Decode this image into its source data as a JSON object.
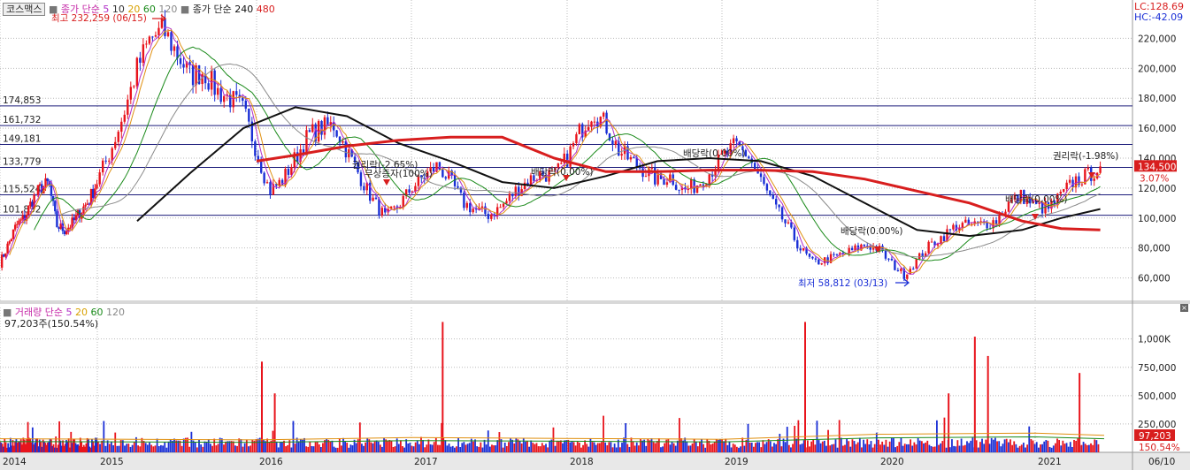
{
  "header": {
    "name": "코스맥스",
    "price_legend": [
      "종가",
      "단순",
      "5",
      "10",
      "20",
      "60",
      "120",
      "종가",
      "단순",
      "240",
      "480"
    ],
    "lc": "LC:128.69",
    "hc": "HC:-42.09"
  },
  "volume_header": {
    "legend": [
      "거래량",
      "단순",
      "5",
      "20",
      "60",
      "120"
    ],
    "last": "97,203주(150.54%)"
  },
  "colors": {
    "up": "#e8141c",
    "down": "#1a2fd6",
    "ma5": "#b02fc8",
    "ma10": "#d8b800",
    "ma20": "#e09010",
    "ma60": "#1a8a1a",
    "ma120": "#8a8a8a",
    "ma240": "#111111",
    "ma480": "#d81e1e",
    "hline": "#1b1b7a"
  },
  "annotations": {
    "high": "최고 232,259 (06/15)",
    "low": "최저 58,812 (03/13)",
    "events": [
      "권리락(-2.65%)",
      "무상증자(100%)",
      "배당락(0.00%)",
      "배당락(0.00%)",
      "배당락(0.00%)",
      "배당락(0.00%)",
      "권리락(-1.98%)"
    ],
    "current_price": "134,500",
    "current_change": "3.07%",
    "current_volume": "97,203",
    "current_volume_pct": "150.54%"
  },
  "chart_data": [
    {
      "type": "line",
      "title": "",
      "y_ticks": [
        60000,
        80000,
        100000,
        120000,
        140000,
        160000,
        180000,
        200000,
        220000
      ],
      "y_tick_labels": [
        "60,000",
        "80,000",
        "100,000",
        "120,000",
        "140,000",
        "160,000",
        "180,000",
        "200,000",
        "220,000"
      ],
      "ylim": [
        45000,
        235000
      ],
      "x_ticks": [
        "2014",
        "2015",
        "2016",
        "2017",
        "2018",
        "2019",
        "2020",
        "2021",
        "06/10"
      ],
      "xlim": [
        "2014-01",
        "2021-06"
      ],
      "levels": [
        174853,
        161732,
        149181,
        133779,
        115524,
        101832
      ],
      "level_labels": [
        "174,853",
        "161,732",
        "149,181",
        "133,779",
        "115,524",
        "101,832"
      ],
      "series": [
        {
          "name": "종가",
          "x": [
            "2014-01",
            "2014-02",
            "2014-03",
            "2014-04",
            "2014-05",
            "2014-06",
            "2014-07",
            "2014-08",
            "2014-09",
            "2014-10",
            "2014-11",
            "2014-12",
            "2015-01",
            "2015-02",
            "2015-03",
            "2015-04",
            "2015-05",
            "2015-06",
            "2015-07",
            "2015-08",
            "2015-09",
            "2015-10",
            "2015-11",
            "2015-12",
            "2016-01",
            "2016-02",
            "2016-03",
            "2016-04",
            "2016-05",
            "2016-06",
            "2016-07",
            "2016-08",
            "2016-09",
            "2016-10",
            "2016-11",
            "2016-12",
            "2017-01",
            "2017-02",
            "2017-03",
            "2017-04",
            "2017-05",
            "2017-06",
            "2017-07",
            "2017-08",
            "2017-09",
            "2017-10",
            "2017-11",
            "2017-12",
            "2018-01",
            "2018-02",
            "2018-03",
            "2018-04",
            "2018-05",
            "2018-06",
            "2018-07",
            "2018-08",
            "2018-09",
            "2018-10",
            "2018-11",
            "2018-12",
            "2019-01",
            "2019-02",
            "2019-03",
            "2019-04",
            "2019-05",
            "2019-06",
            "2019-07",
            "2019-08",
            "2019-09",
            "2019-10",
            "2019-11",
            "2019-12",
            "2020-01",
            "2020-02",
            "2020-03",
            "2020-04",
            "2020-05",
            "2020-06",
            "2020-07",
            "2020-08",
            "2020-09",
            "2020-10",
            "2020-11",
            "2020-12",
            "2021-01",
            "2021-02",
            "2021-03",
            "2021-04",
            "2021-05",
            "2021-06"
          ],
          "values": [
            70000,
            82000,
            95000,
            100000,
            112000,
            120000,
            123000,
            95000,
            92000,
            97000,
            105000,
            112000,
            125000,
            145000,
            170000,
            200000,
            220000,
            225000,
            210000,
            195000,
            198000,
            185000,
            180000,
            172000,
            145000,
            118000,
            125000,
            140000,
            155000,
            160000,
            162000,
            145000,
            128000,
            112000,
            100000,
            108000,
            120000,
            128000,
            135000,
            125000,
            110000,
            105000,
            102000,
            108000,
            118000,
            125000,
            130000,
            128000,
            140000,
            158000,
            172000,
            162000,
            145000,
            138000,
            132000,
            125000,
            128000,
            118000,
            122000,
            130000,
            140000,
            148000,
            142000,
            125000,
            108000,
            95000,
            80000,
            70000,
            72000,
            75000,
            78000,
            82000,
            80000,
            70000,
            62000,
            72000,
            82000,
            88000,
            95000,
            95000,
            96000,
            98000,
            110000,
            115000,
            108000,
            106000,
            115000,
            125000,
            128000,
            134500
          ]
        },
        {
          "name": "240",
          "x": [
            "2015-04",
            "2015-08",
            "2015-12",
            "2016-04",
            "2016-08",
            "2016-12",
            "2017-04",
            "2017-08",
            "2017-12",
            "2018-04",
            "2018-08",
            "2018-12",
            "2019-04",
            "2019-08",
            "2019-12",
            "2020-04",
            "2020-08",
            "2020-12",
            "2021-03",
            "2021-06"
          ],
          "values": [
            98000,
            130000,
            160000,
            174000,
            168000,
            150000,
            138000,
            124000,
            120000,
            128000,
            138000,
            140000,
            138000,
            128000,
            110000,
            92000,
            88000,
            92000,
            100000,
            106000
          ]
        },
        {
          "name": "480",
          "x": [
            "2016-01",
            "2016-04",
            "2016-08",
            "2016-12",
            "2017-04",
            "2017-08",
            "2017-12",
            "2018-04",
            "2018-08",
            "2018-12",
            "2019-04",
            "2019-08",
            "2019-12",
            "2020-04",
            "2020-08",
            "2020-12",
            "2021-03",
            "2021-06"
          ],
          "values": [
            138000,
            142000,
            148000,
            152000,
            154000,
            154000,
            140000,
            131000,
            131000,
            132000,
            132000,
            131000,
            126000,
            118000,
            110000,
            98000,
            93000,
            92000
          ]
        }
      ]
    },
    {
      "type": "bar",
      "title": "",
      "y_ticks": [
        250000,
        500000,
        750000,
        1000000
      ],
      "y_tick_labels": [
        "250,000",
        "500,000",
        "750,000",
        "1,000K"
      ],
      "ylim": [
        0,
        1200000
      ],
      "spikes": [
        {
          "x": "2016-01",
          "value": 800000
        },
        {
          "x": "2016-02",
          "value": 520000
        },
        {
          "x": "2017-03",
          "value": 1150000
        },
        {
          "x": "2019-07",
          "value": 1150000
        },
        {
          "x": "2020-06",
          "value": 520000
        },
        {
          "x": "2020-08",
          "value": 1020000
        },
        {
          "x": "2020-09",
          "value": 850000
        },
        {
          "x": "2021-04",
          "value": 700000
        }
      ]
    }
  ]
}
